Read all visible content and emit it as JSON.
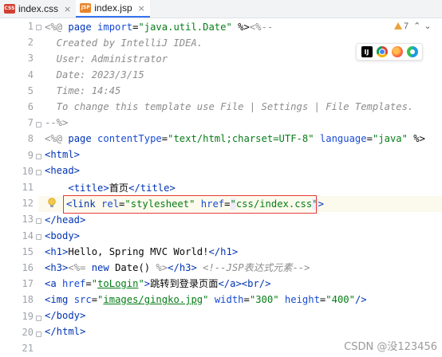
{
  "tabs": [
    {
      "icon": "CSS",
      "label": "index.css",
      "close": "×",
      "active": false
    },
    {
      "icon": "JSP",
      "label": "index.jsp",
      "close": "×",
      "active": true
    }
  ],
  "inspection": {
    "warnings": "7",
    "arrow_up": "⌃",
    "arrow_down": "⌄"
  },
  "browser_icons": [
    "intellij-preview-icon",
    "chrome-icon",
    "firefox-icon",
    "edge-icon"
  ],
  "browser_ij_label": "IJ",
  "line_numbers": [
    "1",
    "2",
    "3",
    "4",
    "5",
    "6",
    "7",
    "8",
    "9",
    "10",
    "11",
    "12",
    "13",
    "14",
    "15",
    "16",
    "17",
    "18",
    "19",
    "20",
    "21"
  ],
  "code": {
    "l1": {
      "a": "<%@ ",
      "b": "page ",
      "c": "import",
      "d": "=",
      "e": "\"java.util.Date\"",
      "f": " %>",
      "g": "<%--"
    },
    "l2": "  Created by IntelliJ IDEA.",
    "l3": "  User: Administrator",
    "l4": "  Date: 2023/3/15",
    "l5": "  Time: 14:45",
    "l6": "  To change this template use File | Settings | File Templates.",
    "l7": "--%>",
    "l8": {
      "a": "<%@ ",
      "b": "page ",
      "c": "contentType",
      "d": "=",
      "e": "\"text/html;charset=UTF-8\"",
      "f": " ",
      "g": "language",
      "h": "=",
      "i": "\"java\"",
      "j": " %>"
    },
    "l9": "<html>",
    "l10": "<head>",
    "l11": {
      "indent": "    ",
      "open": "<title>",
      "text": "首页",
      "close": "</title>"
    },
    "l12": {
      "p1": "<link ",
      "p2": "rel",
      "p3": "=",
      "p4": "\"stylesheet\"",
      "p5": " ",
      "p6": "href",
      "p7": "=",
      "p8a": "\"",
      "p8b": "css/index.css",
      "p8c": "\"",
      "p9": ">"
    },
    "l13": "</head>",
    "l14": "<body>",
    "l15": {
      "open": "<h1>",
      "text": "Hello, Spring MVC World!",
      "close": "</h1>"
    },
    "l16": {
      "open": "<h3>",
      "sopen": "<%= ",
      "kw": "new ",
      "cls": "Date",
      "paren": "()",
      "sclose": " %>",
      "close": "</h3>",
      "sp": " ",
      "comment": "<!--JSP表达式元素-->"
    },
    "l17": {
      "open": "<a ",
      "attr": "href",
      "eq": "=",
      "q1": "\"",
      "val": "toLogin",
      "q2": "\"",
      "gt": ">",
      "text": "跳转到登录页面",
      "close": "</a>",
      "br": "<br/>"
    },
    "l18": {
      "open": "<img ",
      "a1": "src",
      "eq1": "=",
      "v1q1": "\"",
      "v1": "images/gingko.jpg",
      "v1q2": "\"",
      "sp1": " ",
      "a2": "width",
      "eq2": "=",
      "v2": "\"300\"",
      "sp2": " ",
      "a3": "height",
      "eq3": "=",
      "v3": "\"400\"",
      "end": "/>"
    },
    "l19": "</body>",
    "l20": "</html>"
  },
  "watermark": "CSDN @没123456",
  "colors": {
    "keyword": "#0033b3",
    "string": "#067d17",
    "comment": "#8c8c8c",
    "highlight_box": "#e53935",
    "active_tab_underline": "#3574f0"
  }
}
